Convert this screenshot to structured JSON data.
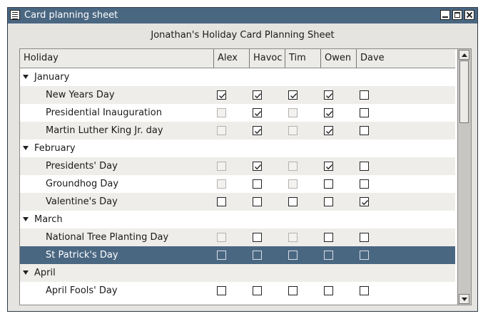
{
  "window": {
    "title": "Card planning sheet"
  },
  "sheet_title": "Jonathan's Holiday Card Planning Sheet",
  "columns": [
    "Holiday",
    "Alex",
    "Havoc",
    "Tim",
    "Owen",
    "Dave"
  ],
  "rows": [
    {
      "type": "group",
      "label": "January"
    },
    {
      "type": "item",
      "label": "New Years Day",
      "checks": [
        true,
        true,
        true,
        true,
        false
      ],
      "disabled": [
        false,
        false,
        false,
        false,
        false
      ]
    },
    {
      "type": "item",
      "label": "Presidential Inauguration",
      "checks": [
        false,
        true,
        false,
        true,
        false
      ],
      "disabled": [
        true,
        false,
        true,
        false,
        false
      ]
    },
    {
      "type": "item",
      "label": "Martin Luther King Jr. day",
      "checks": [
        false,
        true,
        false,
        true,
        false
      ],
      "disabled": [
        true,
        false,
        true,
        false,
        false
      ]
    },
    {
      "type": "group",
      "label": "February"
    },
    {
      "type": "item",
      "label": "Presidents' Day",
      "checks": [
        false,
        true,
        false,
        true,
        false
      ],
      "disabled": [
        true,
        false,
        true,
        false,
        false
      ]
    },
    {
      "type": "item",
      "label": "Groundhog Day",
      "checks": [
        false,
        false,
        false,
        false,
        false
      ],
      "disabled": [
        true,
        false,
        true,
        false,
        false
      ]
    },
    {
      "type": "item",
      "label": "Valentine's Day",
      "checks": [
        false,
        false,
        false,
        false,
        true
      ],
      "disabled": [
        false,
        false,
        false,
        false,
        false
      ]
    },
    {
      "type": "group",
      "label": "March"
    },
    {
      "type": "item",
      "label": "National Tree Planting Day",
      "checks": [
        false,
        false,
        false,
        false,
        false
      ],
      "disabled": [
        true,
        false,
        true,
        false,
        false
      ]
    },
    {
      "type": "item",
      "label": "St Patrick's Day",
      "checks": [
        false,
        false,
        false,
        false,
        false
      ],
      "disabled": [
        false,
        false,
        false,
        false,
        false
      ],
      "selected": true
    },
    {
      "type": "group",
      "label": "April"
    },
    {
      "type": "item",
      "label": "April Fools' Day",
      "checks": [
        false,
        false,
        false,
        false,
        false
      ],
      "disabled": [
        false,
        false,
        false,
        false,
        false
      ]
    }
  ]
}
